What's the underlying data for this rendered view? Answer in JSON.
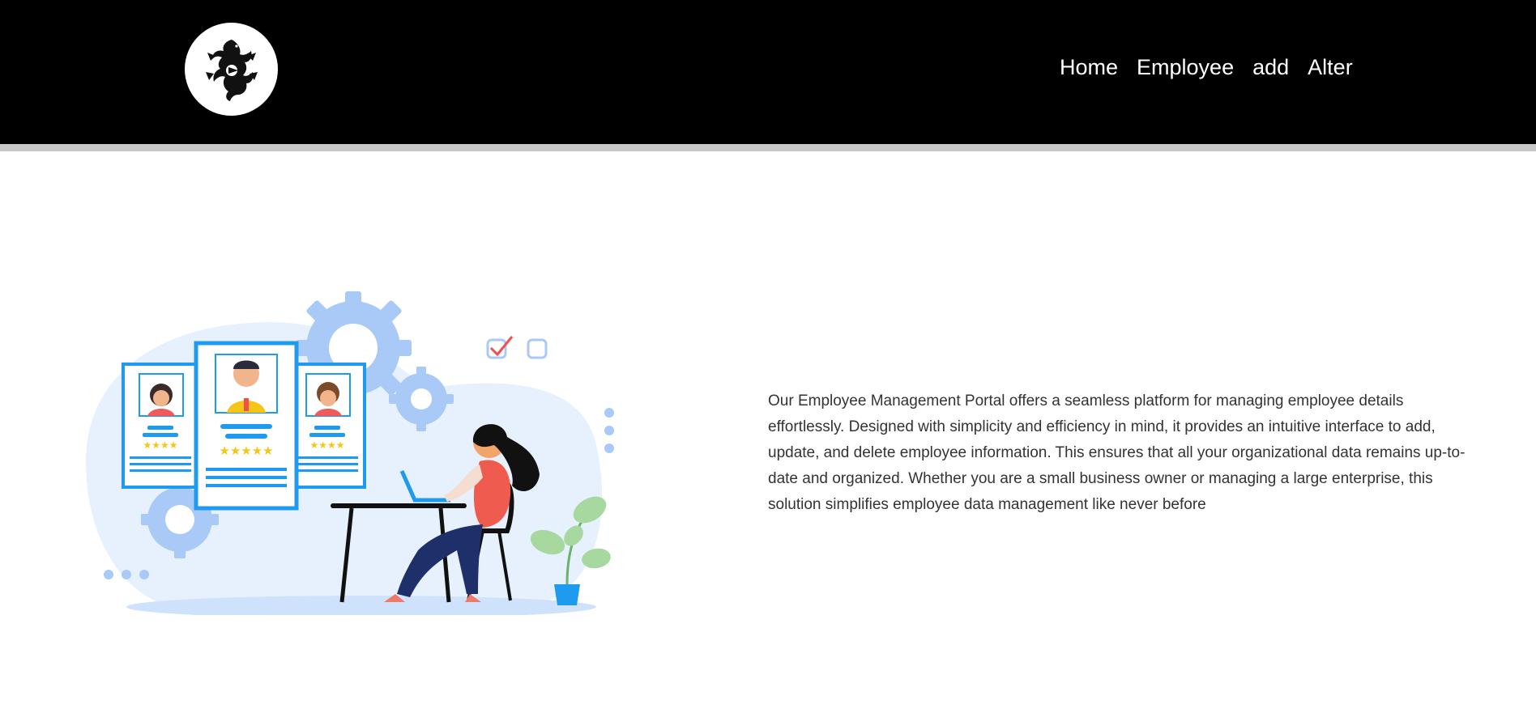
{
  "navbar": {
    "logo_icon": "dragon-emblem-icon",
    "links": [
      {
        "label": "Home"
      },
      {
        "label": "Employee"
      },
      {
        "label": "add"
      },
      {
        "label": "Alter"
      }
    ]
  },
  "hero": {
    "illustration_icon": "employee-management-illustration",
    "description": "Our Employee Management Portal offers a seamless platform for managing employee details effortlessly. Designed with simplicity and efficiency in mind, it provides an intuitive interface to add, update, and delete employee information. This ensures that all your organizational data remains up-to-date and organized. Whether you are a small business owner or managing a large enterprise, this solution simplifies employee data management like never before"
  },
  "colors": {
    "navbar_bg": "#000000",
    "nav_text": "#ffffff",
    "accent_blue": "#1e9bef",
    "light_blue": "#a9c9f7",
    "star_yellow": "#f5c518"
  }
}
